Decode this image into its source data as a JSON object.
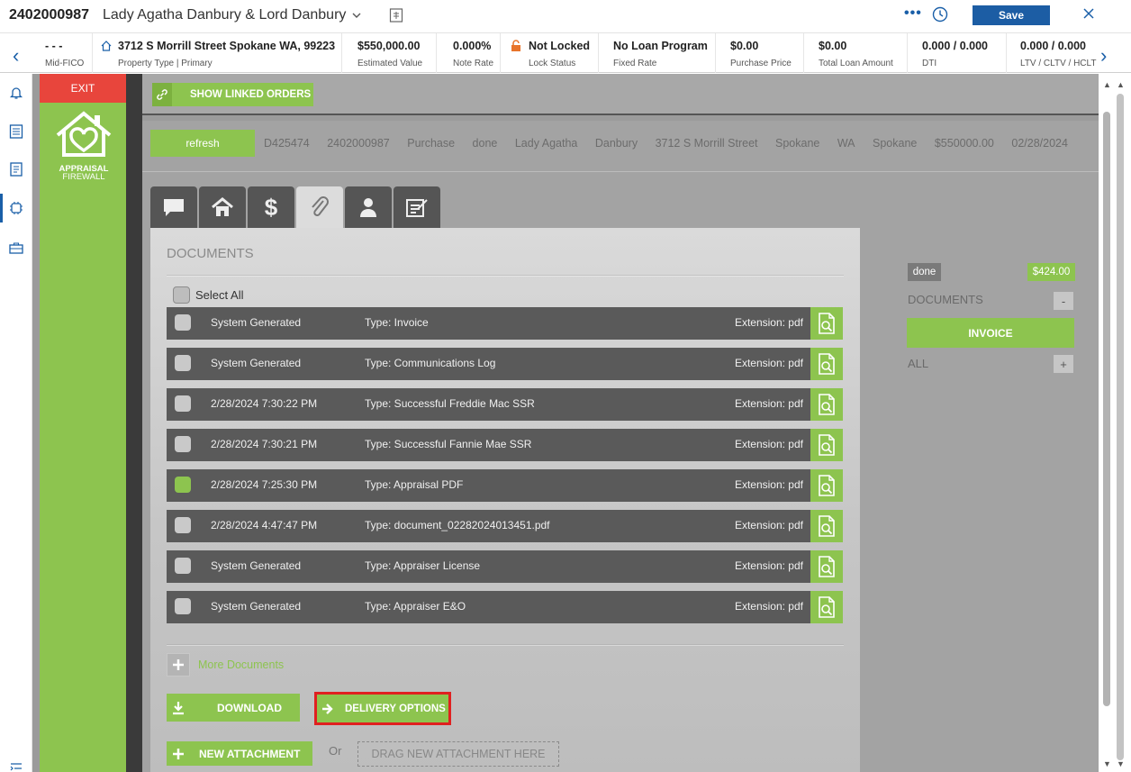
{
  "header": {
    "loan_number": "2402000987",
    "borrower": "Lady Agatha Danbury & Lord Danbury",
    "more": "•••",
    "save_label": "Save"
  },
  "infobar": {
    "fico": {
      "value": "- - -",
      "label": "Mid-FICO"
    },
    "property": {
      "value": "3712 S Morrill Street Spokane WA, 99223",
      "label": "Property Type | Primary"
    },
    "estimated_value": {
      "value": "$550,000.00",
      "label": "Estimated Value"
    },
    "note_rate": {
      "value": "0.000%",
      "label": "Note Rate"
    },
    "lock_status": {
      "value": "Not Locked",
      "label": "Lock Status"
    },
    "loan_program": {
      "value": "No Loan Program",
      "label": "Fixed Rate"
    },
    "purchase_price": {
      "value": "$0.00",
      "label": "Purchase Price"
    },
    "total_loan": {
      "value": "$0.00",
      "label": "Total Loan Amount"
    },
    "dti": {
      "value": "0.000 / 0.000",
      "label": "DTI"
    },
    "ltv": {
      "value": "0.000 / 0.000",
      "label": "LTV / CLTV / HCLT"
    }
  },
  "sidebar": {
    "exit_label": "EXIT",
    "logo_text_1": "APPRAISAL",
    "logo_text_2": "FIREWALL"
  },
  "linked": {
    "label": "SHOW LINKED ORDERS"
  },
  "order": {
    "refresh_label": "refresh",
    "fields": [
      "D425474",
      "2402000987",
      "Purchase",
      "done",
      "Lady Agatha",
      "Danbury",
      "3712 S Morrill Street",
      "Spokane",
      "WA",
      "Spokane",
      "$550000.00",
      "02/28/2024"
    ]
  },
  "documents": {
    "title": "DOCUMENTS",
    "select_all": "Select All",
    "rows": [
      {
        "date": "System Generated",
        "type": "Type: Invoice",
        "ext": "Extension: pdf",
        "checked": false
      },
      {
        "date": "System Generated",
        "type": "Type: Communications Log",
        "ext": "Extension: pdf",
        "checked": false
      },
      {
        "date": "2/28/2024 7:30:22 PM",
        "type": "Type: Successful Freddie Mac SSR",
        "ext": "Extension: pdf",
        "checked": false
      },
      {
        "date": "2/28/2024 7:30:21 PM",
        "type": "Type: Successful Fannie Mae SSR",
        "ext": "Extension: pdf",
        "checked": false
      },
      {
        "date": "2/28/2024 7:25:30 PM",
        "type": "Type: Appraisal PDF",
        "ext": "Extension: pdf",
        "checked": true
      },
      {
        "date": "2/28/2024 4:47:47 PM",
        "type": "Type: document_02282024013451.pdf",
        "ext": "Extension: pdf",
        "checked": false
      },
      {
        "date": "System Generated",
        "type": "Type: Appraiser License",
        "ext": "Extension: pdf",
        "checked": false
      },
      {
        "date": "System Generated",
        "type": "Type: Appraiser E&O",
        "ext": "Extension: pdf",
        "checked": false
      }
    ],
    "more_documents": "More Documents",
    "download_label": "DOWNLOAD",
    "delivery_label": "DELIVERY OPTIONS",
    "new_attachment_label": "NEW ATTACHMENT",
    "or_label": "Or",
    "drop_label": "DRAG NEW ATTACHMENT HERE"
  },
  "side_panel": {
    "status": "done",
    "amount": "$424.00",
    "documents_label": "DOCUMENTS",
    "collapse_symbol": "-",
    "invoice_label": "INVOICE",
    "all_label": "ALL",
    "expand_symbol": "+"
  },
  "colors": {
    "accent_green": "#8dc44f",
    "exit_red": "#e8453c",
    "save_blue": "#1c5da4",
    "highlight_red": "#e02020"
  }
}
